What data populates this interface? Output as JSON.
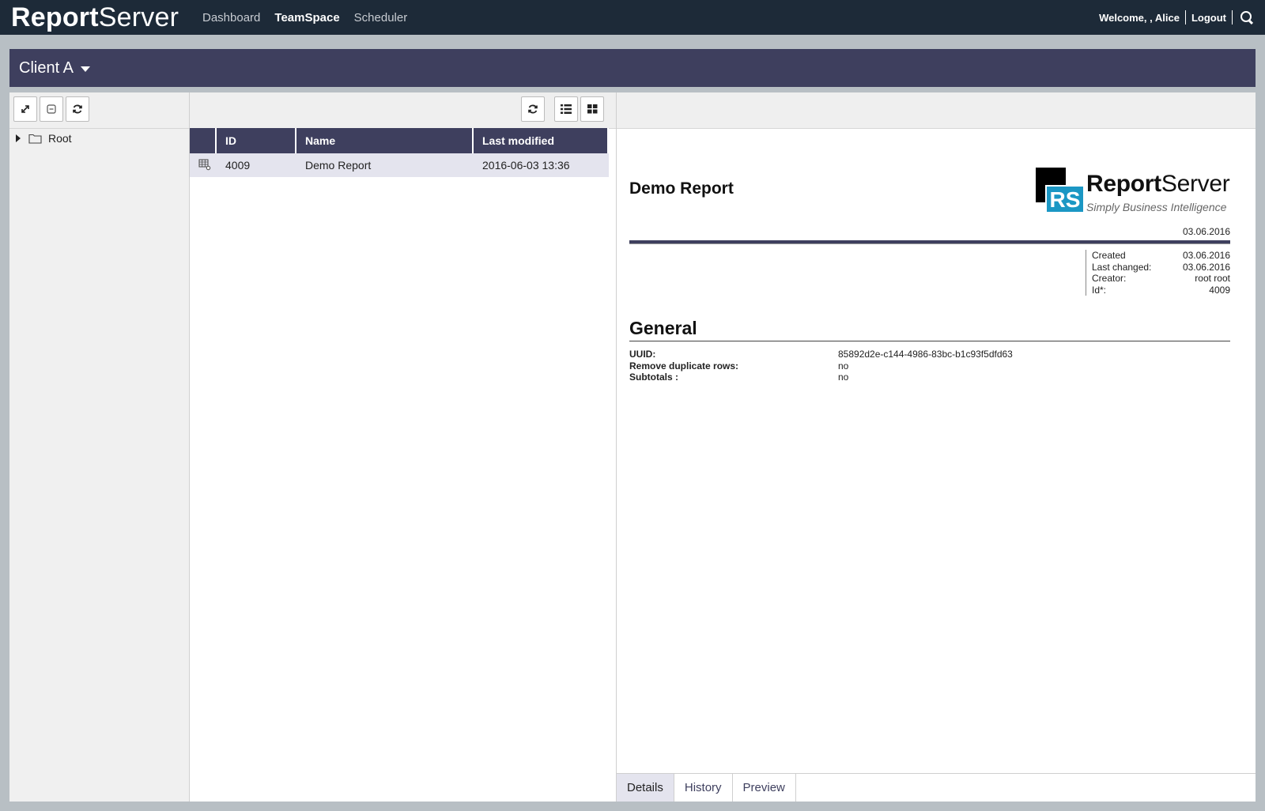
{
  "app": {
    "logo_bold": "Report",
    "logo_light": "Server"
  },
  "nav": {
    "items": [
      {
        "label": "Dashboard"
      },
      {
        "label": "TeamSpace"
      },
      {
        "label": "Scheduler"
      }
    ]
  },
  "user": {
    "welcome": "Welcome, , Alice",
    "logout": "Logout"
  },
  "client": {
    "title": "Client A"
  },
  "tree": {
    "root_label": "Root"
  },
  "grid": {
    "columns": [
      "ID",
      "Name",
      "Last modified"
    ],
    "rows": [
      {
        "id": "4009",
        "name": "Demo Report",
        "modified": "2016-06-03 13:36"
      }
    ]
  },
  "detail": {
    "title": "Demo Report",
    "logo_rs": "RS",
    "logo_bold": "Report",
    "logo_light": "Server",
    "logo_tagline": "Simply Business Intelligence",
    "date": "03.06.2016",
    "meta": [
      {
        "k": "Created",
        "v": "03.06.2016"
      },
      {
        "k": "Last changed:",
        "v": "03.06.2016"
      },
      {
        "k": "Creator:",
        "v": "root root"
      },
      {
        "k": "Id*:",
        "v": "4009"
      }
    ],
    "section_title": "General",
    "props": [
      {
        "k": "UUID:",
        "v": "85892d2e-c144-4986-83bc-b1c93f5dfd63"
      },
      {
        "k": "Remove duplicate rows:",
        "v": "no"
      },
      {
        "k": "Subtotals :",
        "v": "no"
      }
    ]
  },
  "tabs": [
    {
      "label": "Details"
    },
    {
      "label": "History"
    },
    {
      "label": "Preview"
    }
  ],
  "colors": {
    "topbar": "#1d2a38",
    "accent": "#3e3f5e",
    "selected_row": "#e4e4ee",
    "logo_blue": "#1b97c4"
  }
}
